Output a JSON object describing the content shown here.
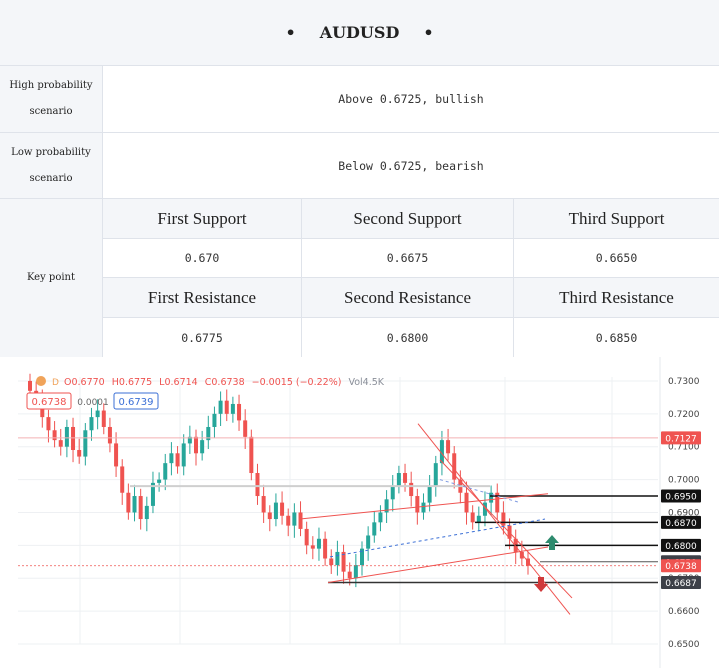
{
  "header": {
    "bullet_left": "•",
    "title": "AUDUSD",
    "bullet_right": "•"
  },
  "scenarios": {
    "high": {
      "label": "High probability scenario",
      "value": "Above 0.6725, bullish"
    },
    "low": {
      "label": "Low probability scenario",
      "value": "Below 0.6725, bearish"
    }
  },
  "key_point": {
    "label": "Key point",
    "supports": [
      {
        "name": "First Support",
        "value": "0.670"
      },
      {
        "name": "Second Support",
        "value": "0.6675"
      },
      {
        "name": "Third  Support",
        "value": "0.6650"
      }
    ],
    "resistances": [
      {
        "name": "First Resistance",
        "value": "0.6775"
      },
      {
        "name": "Second Resistance",
        "value": "0.6800"
      },
      {
        "name": "Third  Resistance",
        "value": "0.6850"
      }
    ]
  },
  "chart_data": {
    "type": "candlestick",
    "ohlc_text": {
      "open": "O0.6770",
      "high": "H0.6775",
      "low": "L0.6714",
      "close": "C0.6738",
      "change": "−0.0015 (−0.22%)",
      "volume": "Vol4.5K"
    },
    "bid_price": "0.6738",
    "spread": "0.0001",
    "ask_price": "0.6739",
    "ylim": [
      0.65,
      0.7312
    ],
    "y_ticks": [
      "0.7300",
      "0.7200",
      "0.7100",
      "0.7000",
      "0.6900",
      "0.6800",
      "0.6700",
      "0.6600",
      "0.6500"
    ],
    "price_labels": [
      {
        "text": "0.7127",
        "value": 0.7127,
        "style": "red"
      },
      {
        "text": "0.6950",
        "value": 0.695,
        "style": "black"
      },
      {
        "text": "0.6870",
        "value": 0.687,
        "style": "black"
      },
      {
        "text": "0.6800",
        "value": 0.68,
        "style": "black"
      },
      {
        "text": "0.6750",
        "value": 0.675,
        "style": "dark"
      },
      {
        "text": "0.6738",
        "value": 0.6738,
        "style": "red"
      },
      {
        "text": "0.6687",
        "value": 0.6687,
        "style": "dark"
      }
    ],
    "closes": [
      0.727,
      0.724,
      0.719,
      0.715,
      0.712,
      0.71,
      0.716,
      0.709,
      0.707,
      0.715,
      0.719,
      0.721,
      0.716,
      0.711,
      0.704,
      0.696,
      0.69,
      0.695,
      0.688,
      0.692,
      0.699,
      0.7,
      0.705,
      0.708,
      0.704,
      0.711,
      0.713,
      0.708,
      0.712,
      0.716,
      0.72,
      0.724,
      0.72,
      0.723,
      0.718,
      0.713,
      0.702,
      0.695,
      0.69,
      0.688,
      0.693,
      0.689,
      0.686,
      0.69,
      0.685,
      0.68,
      0.679,
      0.682,
      0.676,
      0.674,
      0.678,
      0.672,
      0.67,
      0.674,
      0.679,
      0.683,
      0.687,
      0.69,
      0.694,
      0.698,
      0.702,
      0.699,
      0.695,
      0.69,
      0.693,
      0.698,
      0.705,
      0.712,
      0.708,
      0.7,
      0.696,
      0.69,
      0.687,
      0.689,
      0.693,
      0.696,
      0.69,
      0.686,
      0.682,
      0.678,
      0.676,
      0.6738
    ]
  },
  "colors": {
    "bull": "#26a69a",
    "bear": "#ef5350",
    "arrow_up": "#2e8b6e",
    "arrow_down": "#d0393a",
    "grid": "#eef0f3"
  }
}
